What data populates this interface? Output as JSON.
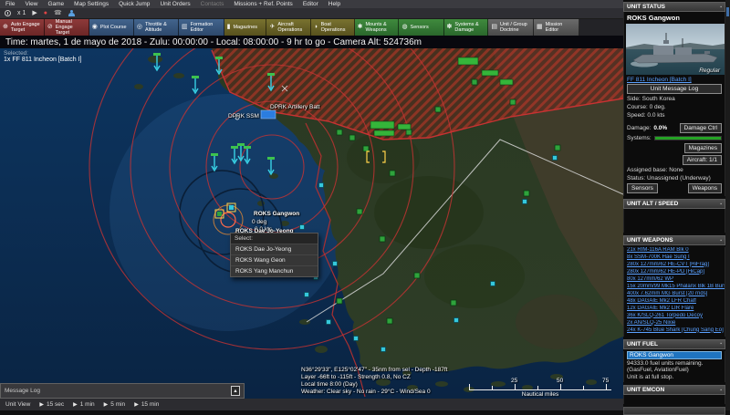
{
  "menu": {
    "items": [
      "File",
      "View",
      "Game",
      "Map Settings",
      "Quick Jump",
      "Unit Orders",
      "Contacts",
      "Missions + Ref. Points",
      "Editor",
      "Help"
    ],
    "disabled_item": "Contacts"
  },
  "icons": {
    "play": "▶",
    "record": "●",
    "phone": "☎",
    "pin": "▪",
    "expand_up": "▲",
    "step_play": "▶"
  },
  "transport": {
    "speed_label": "x 1"
  },
  "toolbar": {
    "buttons": [
      {
        "label": "Auto Engage Target",
        "icon": "⊕"
      },
      {
        "label": "Manual Engage Target",
        "icon": "⊘"
      },
      {
        "label": "Plot Course",
        "icon": "◉"
      },
      {
        "label": "Throttle & Altitude",
        "icon": "◎"
      },
      {
        "label": "Formation Editor",
        "icon": "▥"
      },
      {
        "label": "Magazines",
        "icon": "▮"
      },
      {
        "label": "Aircraft Operations",
        "icon": "✈"
      },
      {
        "label": "Boat Operations",
        "icon": "◗"
      },
      {
        "label": "Mounts & Weapons",
        "icon": "✱"
      },
      {
        "label": "Sensors",
        "icon": "◍"
      },
      {
        "label": "Systems & Damage",
        "icon": "✽"
      },
      {
        "label": "Unit / Group Doctrine",
        "icon": "▤"
      },
      {
        "label": "Mission Editor",
        "icon": "▦"
      }
    ]
  },
  "timebar": {
    "text": "Time: martes, 1 de mayo de 2018 - Zulu: 00:00:00 -  Local: 08:00:00 - 9 hr to go -  Camera Alt: 524736m"
  },
  "selection": {
    "label": "Selected:",
    "value": "1x FF 811 Incheon [Batch I]"
  },
  "map": {
    "labels": {
      "dprk_artillery": "DPRK Artillery Batt",
      "dprk_ssm": "DPRK SSM",
      "roks_gangwon": "ROKS Gangwon",
      "gangwon_course": "0 deg",
      "gangwon_speed": "0.0 kts",
      "roks_dae": "ROKS Dae Jo-Yeong"
    },
    "context_menu": {
      "title": "Select:",
      "items": [
        "ROKS Dae Jo-Yeong",
        "ROKS Wang Geon",
        "ROKS Yang Manchun"
      ]
    },
    "cursor_info": [
      "N36°29'33\", E125°02'47\" - 35nm from sel - Depth -187ft",
      "Layer -66ft to -115ft - Strength 0.8, No CZ",
      "Local time 8:00 (Day)",
      "Weather: Clear sky - No rain - 29°C - Wind/Sea 0"
    ],
    "scale": {
      "ticks": [
        "25",
        "50",
        "75"
      ],
      "caption": "Nautical miles"
    }
  },
  "message_log": {
    "title": "Message Log"
  },
  "time_controls": {
    "view_label": "Unit View",
    "steps": [
      "15 sec",
      "1 min",
      "5 min",
      "15 min"
    ]
  },
  "sidebar": {
    "unit_status": {
      "header": "UNIT STATUS",
      "unit_name": "ROKS Gangwon",
      "photo_caption": "Regular",
      "class_link": "FF 811 Incheon [Batch I]",
      "message_log_button": "Unit Message Log",
      "side": "Side: South Korea",
      "course": "Course: 0 deg.",
      "speed": "Speed: 0.0 kts",
      "damage_label": "Damage:",
      "damage_value": "0.0%",
      "damage_ctrl_button": "Damage Ctrl",
      "systems_label": "Systems:",
      "magazines_button": "Magazines",
      "aircraft_button": "Aircraft: 1/1",
      "assigned_base": "Assigned base: None",
      "status": "Status: Unassigned (Underway)",
      "sensors_button": "Sensors",
      "weapons_button": "Weapons"
    },
    "alt_speed": {
      "header": "UNIT ALT / SPEED"
    },
    "weapons": {
      "header": "UNIT WEAPONS",
      "items": [
        "21x RIM-116A RAM Blk 0",
        "8x SSM-700K Hae Sung I",
        "280x 127mm/62 HE-CVT [HiFrag]",
        "280x 127mm/62 HE-PD [HiCap]",
        "80x 127mm/62 WP",
        "15x 20mm/99 Mk15 Phalanx Blk 1B Burst",
        "400x 7.62mm MG Burst [20 rnds]",
        "48x DAGAIE Mk2 LFR Chaff",
        "12x DAGAIE Mk2 LIR Flare",
        "36x K/SLQ-261 Torpedo Decoy",
        "2x AN/SLQ-25 Nixie",
        "24x K-745 Blue Shark [Chung Sang Eo]"
      ]
    },
    "fuel": {
      "header": "UNIT FUEL",
      "selected_unit": "ROKS Gangwon",
      "lines": [
        "94333.0 fuel units remaining.",
        "(GasFuel, AviationFuel)",
        "Unit is at full stop."
      ]
    },
    "emcon": {
      "header": "UNIT EMCON"
    }
  },
  "colors": {
    "link_blue": "#5aa0ff",
    "systems_green": "#25a325",
    "fuel_selected_blue": "#1f74c0",
    "range_ring_red": "#c63333",
    "friendly_cyan": "#38d2e6",
    "facility_green": "#2fa33c",
    "hostile_hatch_red": "#c83232"
  }
}
